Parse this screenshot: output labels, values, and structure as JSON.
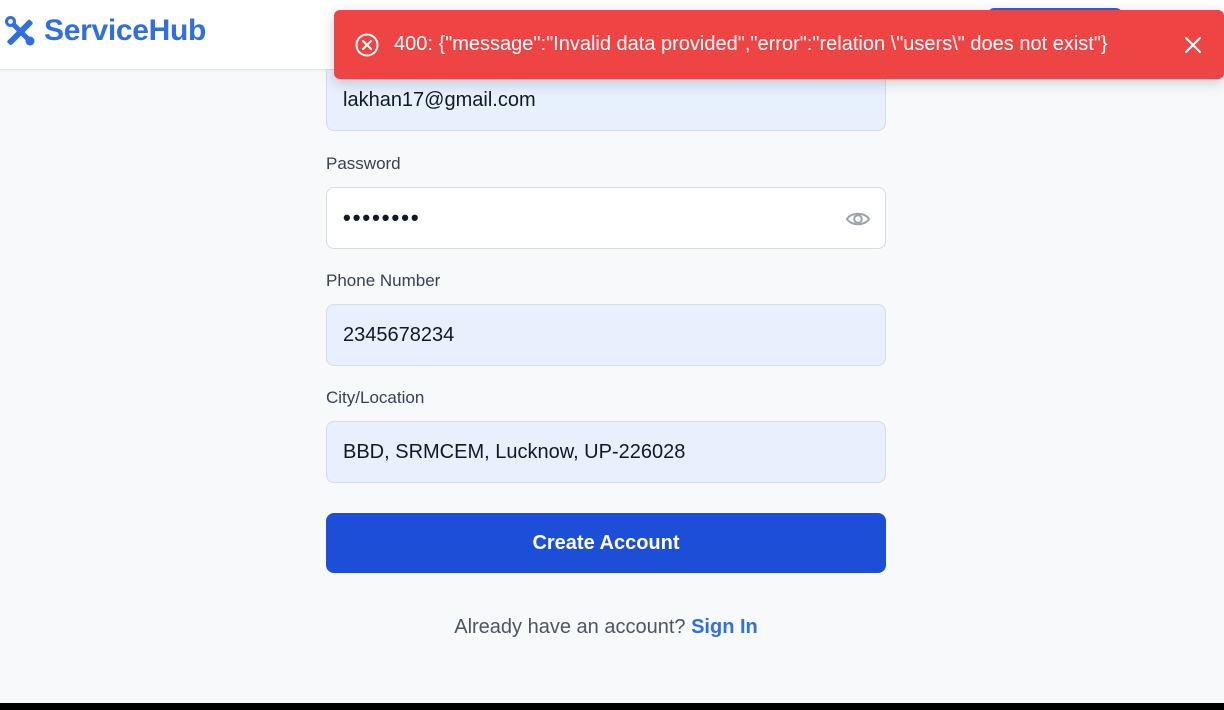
{
  "header": {
    "brand_name": "ServiceHub",
    "brand_icon": "tools-icon",
    "brand_color": "#2f6fe0"
  },
  "toast": {
    "message": "400: {\"message\":\"Invalid data provided\",\"error\":\"relation \\\"users\\\" does not exist\"}",
    "icon": "error-circle-icon",
    "close_icon": "close-icon",
    "color": "#ef4444"
  },
  "form": {
    "email": {
      "value": "lakhan17@gmail.com"
    },
    "password": {
      "label": "Password",
      "masked_value": "••••••••",
      "toggle_icon": "eye-icon"
    },
    "phone": {
      "label": "Phone Number",
      "value": "2345678234"
    },
    "city": {
      "label": "City/Location",
      "value": "BBD, SRMCEM, Lucknow, UP-226028"
    },
    "submit_label": "Create Account",
    "signin_prompt": "Already have an account?",
    "signin_link": "Sign In"
  },
  "colors": {
    "primary_button": "#1d4ed8",
    "autofill_bg": "#e8effd",
    "page_bg": "#f8f9fb"
  }
}
